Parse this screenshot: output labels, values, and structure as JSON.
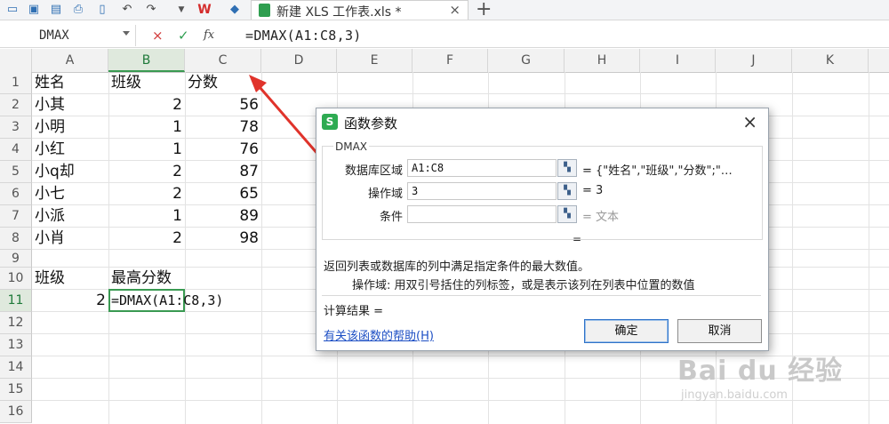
{
  "toolbar": {
    "file_tab_title": "新建 XLS 工作表.xls *",
    "close_glyph": "×",
    "add_glyph": "+"
  },
  "formula_bar": {
    "name_box": "DMAX",
    "cancel_glyph": "×",
    "enter_glyph": "✓",
    "fx_label": "fx",
    "formula": "=DMAX(A1:C8,3)"
  },
  "grid": {
    "columns": [
      "A",
      "B",
      "C",
      "D",
      "E",
      "F",
      "G",
      "H",
      "I",
      "J",
      "K"
    ],
    "rows": [
      "1",
      "2",
      "3",
      "4",
      "5",
      "6",
      "7",
      "8",
      "9",
      "10",
      "11",
      "12",
      "13",
      "14",
      "15",
      "16"
    ],
    "active_column": "B",
    "active_row": "11",
    "cells": {
      "A1": "姓名",
      "B1": "班级",
      "C1": "分数",
      "A2": "小其",
      "B2": "2",
      "C2": "56",
      "A3": "小明",
      "B3": "1",
      "C3": "78",
      "A4": "小红",
      "B4": "1",
      "C4": "76",
      "A5": "小q却",
      "B5": "2",
      "C5": "87",
      "A6": "小七",
      "B6": "2",
      "C6": "65",
      "A7": "小派",
      "B7": "1",
      "C7": "89",
      "A8": "小肖",
      "B8": "2",
      "C8": "98",
      "A10": "班级",
      "B10": "最高分数",
      "A11": "2",
      "B11": "=DMAX(A1:C8,3)"
    }
  },
  "dialog": {
    "logo": "S",
    "title": "函数参数",
    "close_glyph": "×",
    "function_name": "DMAX",
    "params": [
      {
        "label": "数据库区域",
        "value": "A1:C8",
        "result": "= {\"姓名\",\"班级\",\"分数\";\"…"
      },
      {
        "label": "操作域",
        "value": "3",
        "result": "= 3"
      },
      {
        "label": "条件",
        "value": "",
        "result": "= 文本"
      }
    ],
    "equals": "=",
    "description": "返回列表或数据库的列中满足指定条件的最大数值。",
    "param_help": "操作域:  用双引号括住的列标签，或是表示该列在列表中位置的数值",
    "result_label": "计算结果 =",
    "help_link": "有关该函数的帮助(H)",
    "ok_label": "确定",
    "cancel_label": "取消"
  },
  "watermark": {
    "main": "Bai du 经验",
    "sub": "jingyan.baidu.com"
  }
}
